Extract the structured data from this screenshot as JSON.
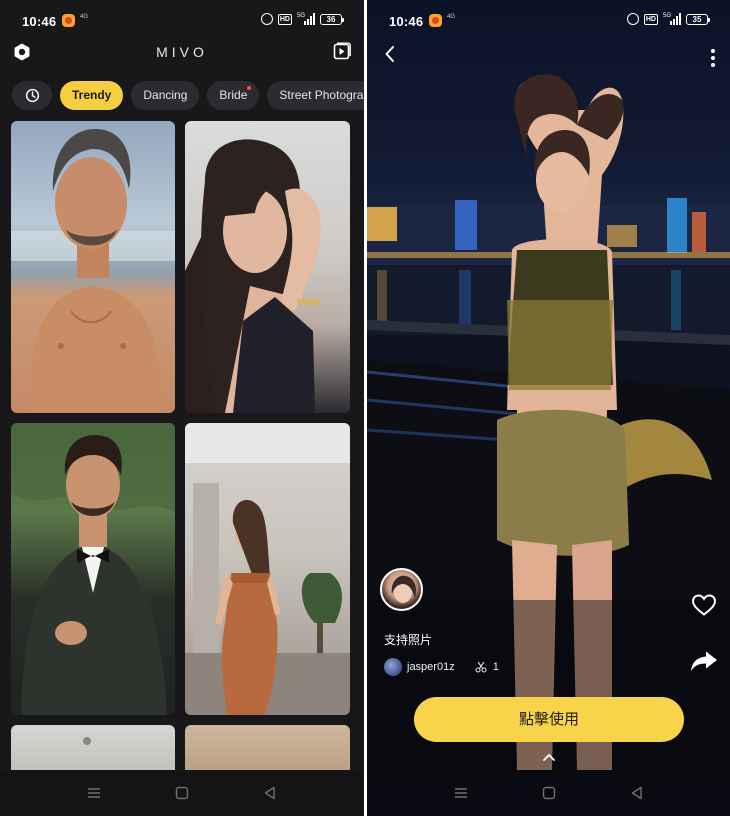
{
  "left_screen": {
    "status_bar": {
      "time": "10:46",
      "network_label": "4G",
      "hd_label": "HD",
      "signal_label": "5G",
      "battery": "36"
    },
    "header": {
      "brand": "MIVO",
      "settings_icon": "settings-gear-icon",
      "media_icon": "media-play-icon"
    },
    "tabs": [
      {
        "icon": "clock-history-icon",
        "label": ""
      },
      {
        "label": "Trendy",
        "active": true
      },
      {
        "label": "Dancing"
      },
      {
        "label": "Bride",
        "badge_dot": true
      },
      {
        "label": "Street Photograp"
      }
    ],
    "grid_items": [
      {
        "name": "shirtless-man-beach-thumbnail"
      },
      {
        "name": "woman-black-halter-thumbnail"
      },
      {
        "name": "man-tuxedo-thumbnail"
      },
      {
        "name": "woman-orange-dress-thumbnail"
      },
      {
        "name": "partial-thumbnail-5"
      },
      {
        "name": "partial-thumbnail-6"
      }
    ],
    "navbar": [
      "menu-icon",
      "home-square-icon",
      "back-triangle-icon"
    ]
  },
  "right_screen": {
    "status_bar": {
      "time": "10:46",
      "network_label": "4G",
      "hd_label": "HD",
      "signal_label": "5G",
      "battery": "35"
    },
    "caption": "支持照片",
    "author": "jasper01z",
    "use_count": "1",
    "cta_label": "點擊使用",
    "colors": {
      "accent_yellow": "#f7d449",
      "tab_active": "#f5cf3f"
    }
  }
}
